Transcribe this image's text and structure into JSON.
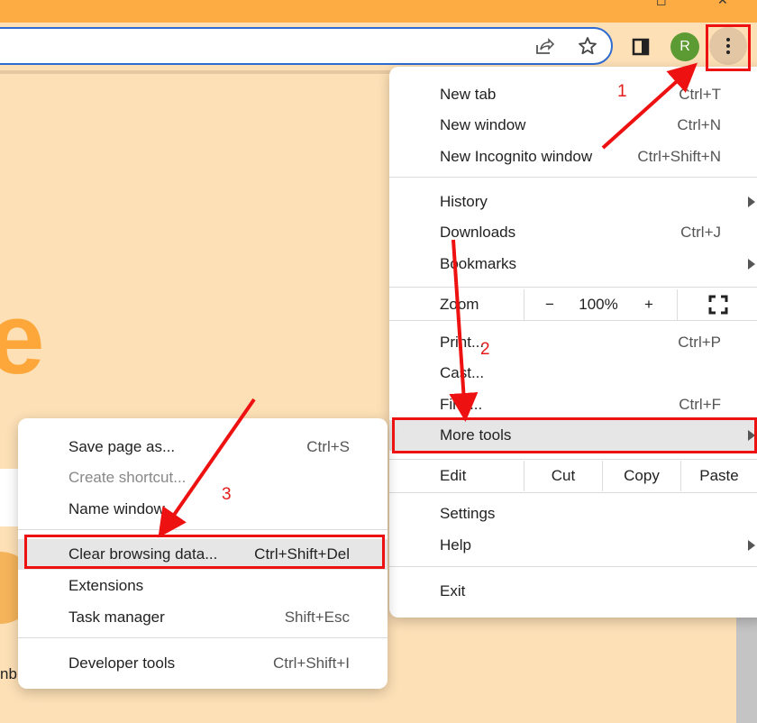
{
  "browser": {
    "window_controls": [
      "restore-icon",
      "close-icon"
    ],
    "toolbar": {
      "share_icon": "share-icon",
      "bookmark_icon": "star-icon",
      "side_panel_icon": "side-panel-icon",
      "profile_initial": "R",
      "menu_icon": "three-dot-menu-icon"
    },
    "colors": {
      "title_bar": "#fdac44",
      "page_background": "#fde0b6",
      "omnibox_border": "#2f6bd0",
      "profile": "#5c9b34",
      "annotation": "#ee1111"
    }
  },
  "page_background": {
    "large_text": "le",
    "fragment_text": "nb"
  },
  "main_menu": {
    "group1": [
      {
        "label": "New tab",
        "shortcut": "Ctrl+T"
      },
      {
        "label": "New window",
        "shortcut": "Ctrl+N"
      },
      {
        "label": "New Incognito window",
        "shortcut": "Ctrl+Shift+N"
      }
    ],
    "group2": [
      {
        "label": "History",
        "shortcut": "",
        "submenu": true
      },
      {
        "label": "Downloads",
        "shortcut": "Ctrl+J"
      },
      {
        "label": "Bookmarks",
        "shortcut": "",
        "submenu": true
      }
    ],
    "zoom": {
      "label": "Zoom",
      "minus": "−",
      "value": "100%",
      "plus": "+",
      "fullscreen_icon": "fullscreen-icon"
    },
    "group3": [
      {
        "label": "Print...",
        "shortcut": "Ctrl+P"
      },
      {
        "label": "Cast...",
        "shortcut": ""
      },
      {
        "label": "Find...",
        "shortcut": "Ctrl+F"
      },
      {
        "label": "More tools",
        "shortcut": "",
        "submenu": true,
        "highlighted": true
      }
    ],
    "edit": {
      "label": "Edit",
      "cut": "Cut",
      "copy": "Copy",
      "paste": "Paste"
    },
    "group4": [
      {
        "label": "Settings",
        "shortcut": ""
      },
      {
        "label": "Help",
        "shortcut": "",
        "submenu": true
      }
    ],
    "exit": {
      "label": "Exit"
    }
  },
  "more_tools_menu": {
    "group1": [
      {
        "label": "Save page as...",
        "shortcut": "Ctrl+S"
      },
      {
        "label": "Create shortcut...",
        "shortcut": "",
        "disabled": true
      },
      {
        "label": "Name window...",
        "shortcut": ""
      }
    ],
    "group2": [
      {
        "label": "Clear browsing data...",
        "shortcut": "Ctrl+Shift+Del",
        "highlighted": true
      },
      {
        "label": "Extensions",
        "shortcut": ""
      },
      {
        "label": "Task manager",
        "shortcut": "Shift+Esc"
      }
    ],
    "group3": [
      {
        "label": "Developer tools",
        "shortcut": "Ctrl+Shift+I"
      }
    ]
  },
  "annotations": {
    "steps": [
      "1",
      "2",
      "3"
    ]
  }
}
